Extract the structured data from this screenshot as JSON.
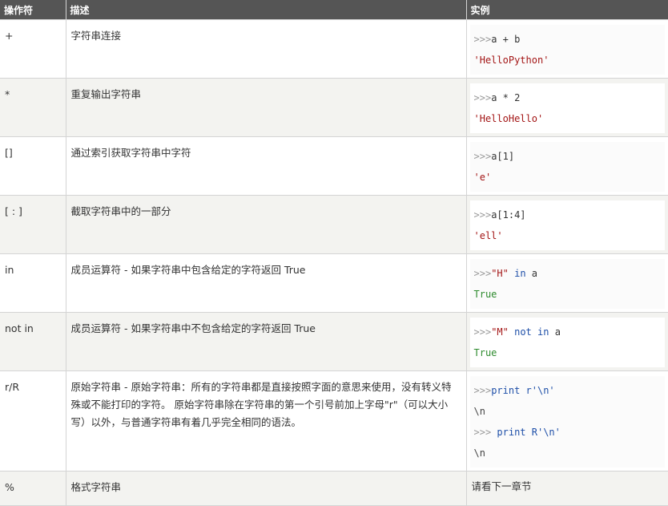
{
  "header": {
    "col_operator": "操作符",
    "col_description": "描述",
    "col_example": "实例"
  },
  "rows": [
    {
      "operator": "+",
      "description": "字符串连接",
      "example": {
        "prompt": ">>>",
        "code": "a + b",
        "output": "'HelloPython'"
      }
    },
    {
      "operator": "*",
      "description": "重复输出字符串",
      "example": {
        "prompt": ">>>",
        "code": "a * 2",
        "output": "'HelloHello'"
      }
    },
    {
      "operator": "[]",
      "description": "通过索引获取字符串中字符",
      "example": {
        "prompt": ">>>",
        "code": "a[1]",
        "output": "'e'"
      }
    },
    {
      "operator": "[ : ]",
      "description": "截取字符串中的一部分",
      "example": {
        "prompt": ">>>",
        "code": "a[1:4]",
        "output": "'ell'"
      }
    },
    {
      "operator": "in",
      "description": "成员运算符 - 如果字符串中包含给定的字符返回 True",
      "example": {
        "prompt": ">>>",
        "str": "\"H\"",
        "kw": "in",
        "var": "a",
        "output": "True"
      }
    },
    {
      "operator": "not in",
      "description": "成员运算符 - 如果字符串中不包含给定的字符返回 True",
      "example": {
        "prompt": ">>>",
        "str": "\"M\"",
        "kw": "not in",
        "var": "a",
        "output": "True"
      }
    },
    {
      "operator": "r/R",
      "description": "原始字符串 - 原始字符串：所有的字符串都是直接按照字面的意思来使用，没有转义特殊或不能打印的字符。 原始字符串除在字符串的第一个引号前加上字母\"r\"（可以大小写）以外，与普通字符串有着几乎完全相同的语法。",
      "example": {
        "line1_prompt": ">>>",
        "line1_code": "print r'\\n'",
        "line2": "\\n",
        "line3_prompt": ">>> ",
        "line3_code": "print R'\\n'",
        "line4": "\\n"
      }
    },
    {
      "operator": "%",
      "description": "格式字符串",
      "example_text": "请看下一章节"
    }
  ]
}
